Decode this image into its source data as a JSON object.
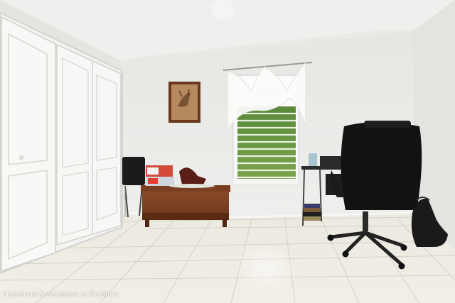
{
  "photo": {
    "watermark": "Heartland Association of Realtors"
  }
}
